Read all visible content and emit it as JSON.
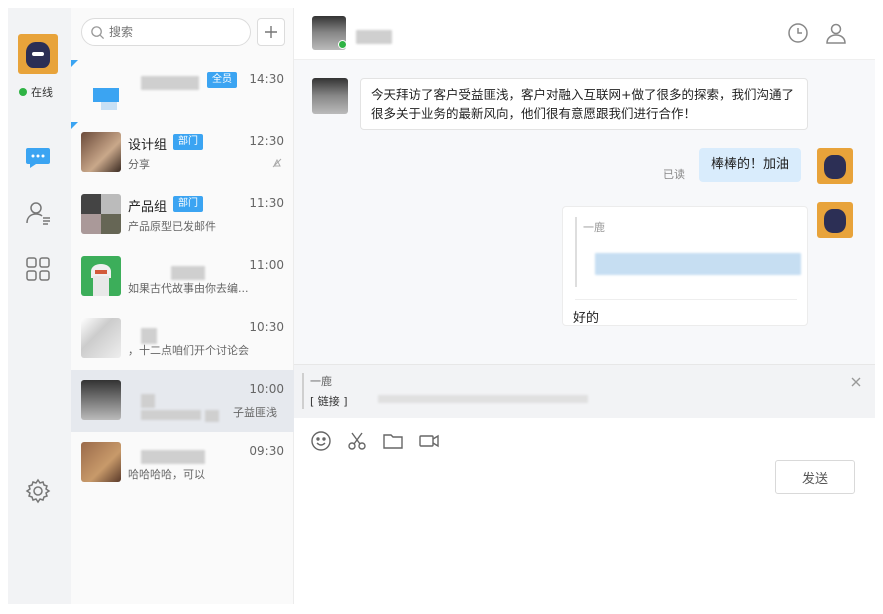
{
  "rail": {
    "status": "在线",
    "status_color": "#2fb344",
    "nav": [
      {
        "name": "chat-nav",
        "icon": "chat-bubble-icon",
        "active": true
      },
      {
        "name": "contacts-nav",
        "icon": "contacts-icon",
        "active": false
      },
      {
        "name": "apps-nav",
        "icon": "grid-icon",
        "active": false
      }
    ],
    "settings_icon": "gear-icon"
  },
  "search": {
    "placeholder": "搜索"
  },
  "conversations": [
    {
      "name": "",
      "tag": "全员",
      "time": "14:30",
      "preview": ""
    },
    {
      "name": "设计组",
      "tag": "部门",
      "time": "12:30",
      "preview": "分享",
      "muted": true
    },
    {
      "name": "产品组",
      "tag": "部门",
      "time": "11:30",
      "preview": "产品原型已发邮件"
    },
    {
      "name": "",
      "tag": "",
      "time": "11:00",
      "preview": "如果古代故事由你去编..."
    },
    {
      "name": "",
      "tag": "",
      "time": "10:30",
      "preview": "，十二点咱们开个讨论会"
    },
    {
      "name": "",
      "tag": "",
      "time": "10:00",
      "preview": "子益匪浅",
      "active": true
    },
    {
      "name": "",
      "tag": "",
      "time": "09:30",
      "preview": "哈哈哈哈，可以"
    }
  ],
  "chat": {
    "messages": {
      "incoming": "今天拜访了客户受益匪浅，客户对融入互联网+做了很多的探索，我们沟通了很多关于业务的最新风向，他们很有意愿跟我们进行合作！",
      "outgoing": "棒棒的！加油",
      "read_receipt": "已读",
      "quoted_name": "一鹿",
      "reply_text": "好的"
    },
    "quote": {
      "name": "一鹿",
      "link": "[ 链接 ]"
    },
    "send_label": "发送",
    "accent": "#3ba4f2",
    "bubble_out_color": "#d9ecfc"
  }
}
